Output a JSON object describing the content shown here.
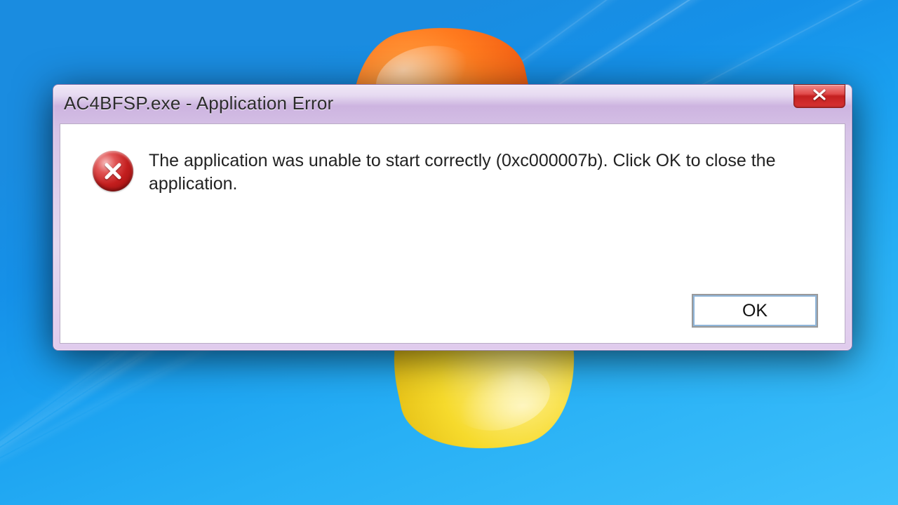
{
  "dialog": {
    "title": "AC4BFSP.exe - Application Error",
    "message": "The application was unable to start correctly (0xc000007b). Click OK to close the application.",
    "ok_label": "OK"
  }
}
